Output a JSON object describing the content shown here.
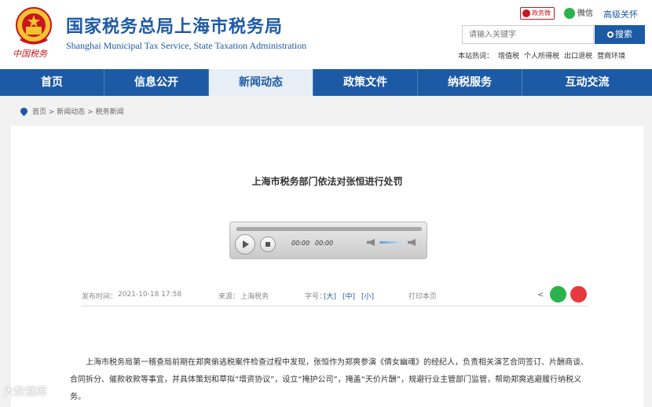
{
  "header": {
    "brand_sub": "中国税务",
    "title_cn": "国家税务总局上海市税务局",
    "title_en": "Shanghai Municipal Tax Service, State Taxation Administration",
    "weibo_label": "政务微",
    "wechat_label": "微信",
    "care_label": "高级关怀",
    "search_placeholder": "请输入关键字",
    "search_button": "搜索",
    "hot_label": "本站热词：",
    "hot_items": [
      "增值税",
      "个人所得税",
      "出口退税",
      "营商环境"
    ]
  },
  "nav": {
    "items": [
      "首页",
      "信息公开",
      "新闻动态",
      "政策文件",
      "纳税服务",
      "互动交流"
    ],
    "active_index": 2
  },
  "breadcrumb": {
    "home": "首页",
    "sep": " > ",
    "level1": "新闻动态",
    "level2": "税务新闻"
  },
  "article": {
    "title": "上海市税务部门依法对张恒进行处罚",
    "player": {
      "current_time": "00:00",
      "duration": "00:00"
    },
    "meta": {
      "date_label": "发布时间：",
      "date": "2021-10-18 17:58",
      "source_label": "来源：",
      "source": "上海税务",
      "font_label": "字号：",
      "font_large": "[大]",
      "font_medium": "[中]",
      "font_small": "[小]",
      "print_label": "打印本页"
    },
    "paragraph": "上海市税务局第一稽查局前期在郑爽偷逃税案件检查过程中发现，张恒作为郑爽参演《倩女幽魂》的经纪人，负责相关演艺合同签订、片酬商谈、合同拆分、催款收款等事宜，并具体策划和草拟“增资协议”，设立“掩护公司”，掩盖“天价片酬”，规避行业主管部门监管，帮助郑爽逃避履行纳税义务。"
  },
  "watermark": "大数据库",
  "colors": {
    "brand_blue": "#1d5aa6",
    "brand_red": "#c8161d",
    "wechat_green": "#2bb24c"
  }
}
